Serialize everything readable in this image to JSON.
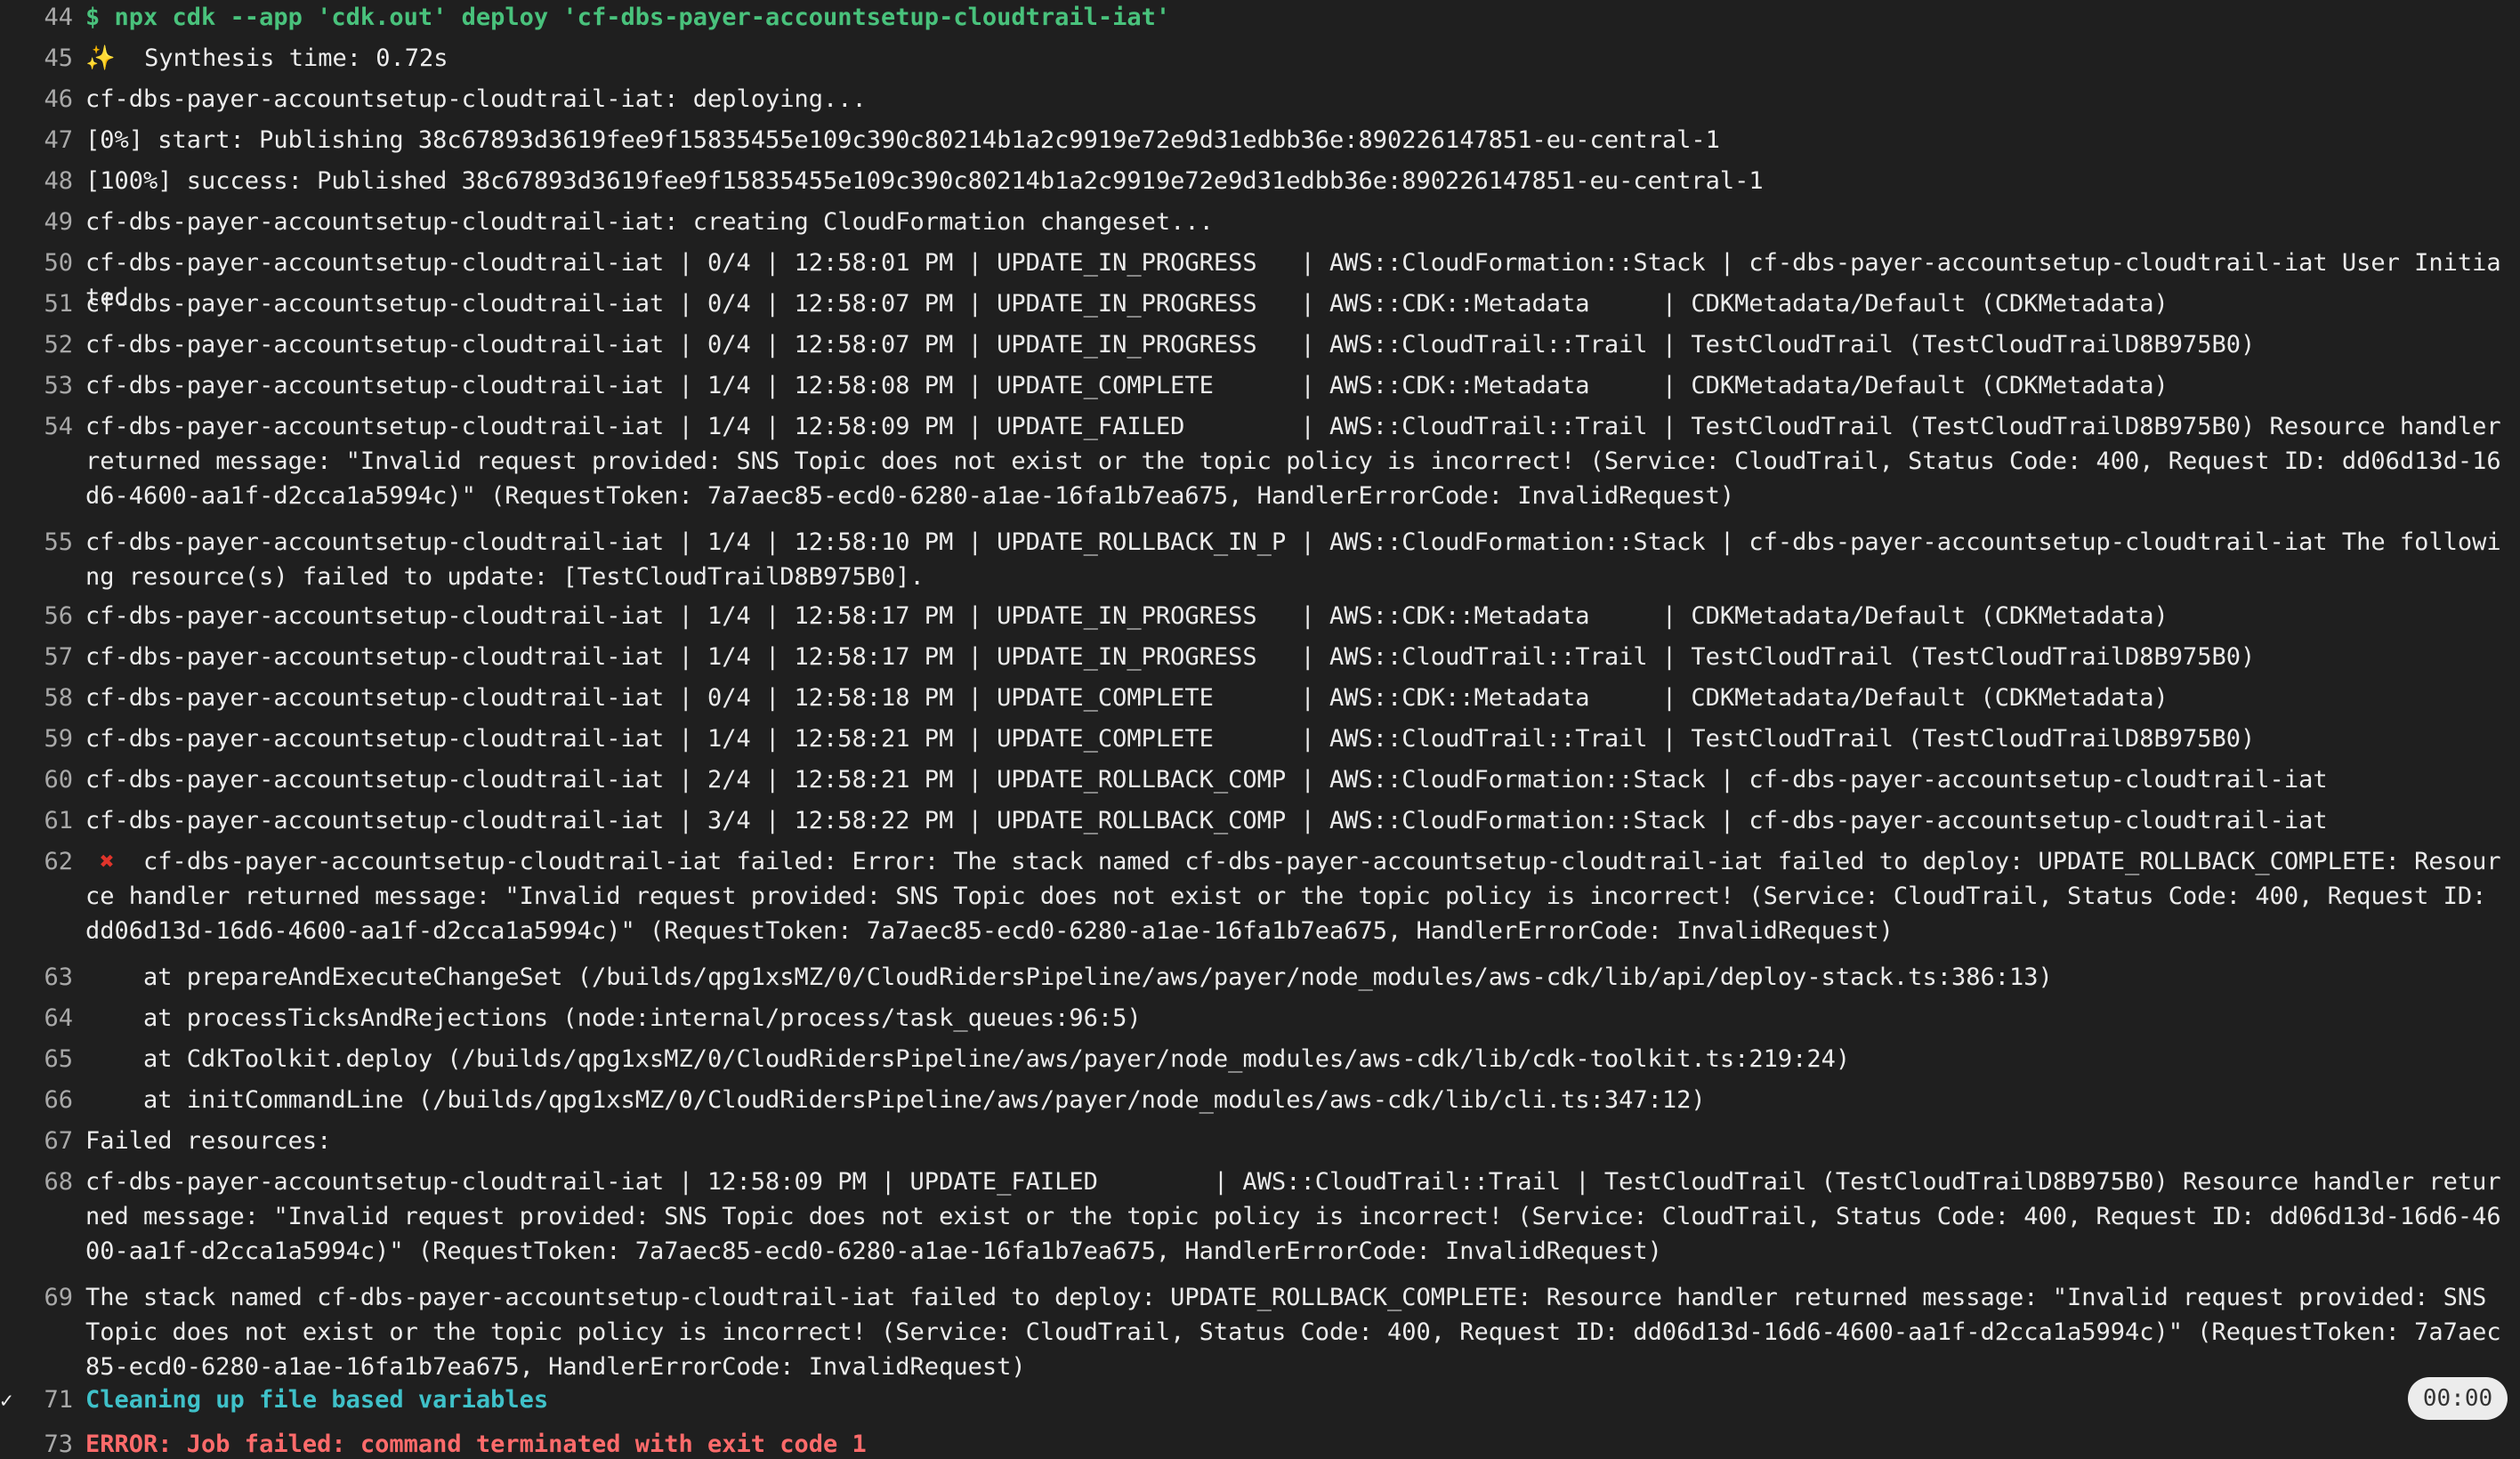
{
  "log": {
    "lines": [
      {
        "n": "44",
        "text": "$ npx cdk --app 'cdk.out' deploy 'cf-dbs-payer-accountsetup-cloudtrail-iat'",
        "style": "green"
      },
      {
        "n": "45",
        "text": "Synthesis time: 0.72s",
        "icon": "sparkle"
      },
      {
        "n": "46",
        "text": "cf-dbs-payer-accountsetup-cloudtrail-iat: deploying..."
      },
      {
        "n": "47",
        "text": "[0%] start: Publishing 38c67893d3619fee9f15835455e109c390c80214b1a2c9919e72e9d31edbb36e:890226147851-eu-central-1"
      },
      {
        "n": "48",
        "text": "[100%] success: Published 38c67893d3619fee9f15835455e109c390c80214b1a2c9919e72e9d31edbb36e:890226147851-eu-central-1"
      },
      {
        "n": "49",
        "text": "cf-dbs-payer-accountsetup-cloudtrail-iat: creating CloudFormation changeset..."
      },
      {
        "n": "50",
        "text": "cf-dbs-payer-accountsetup-cloudtrail-iat | 0/4 | 12:58:01 PM | UPDATE_IN_PROGRESS   | AWS::CloudFormation::Stack | cf-dbs-payer-accountsetup-cloudtrail-iat User Initiated"
      },
      {
        "n": "51",
        "text": "cf-dbs-payer-accountsetup-cloudtrail-iat | 0/4 | 12:58:07 PM | UPDATE_IN_PROGRESS   | AWS::CDK::Metadata     | CDKMetadata/Default (CDKMetadata)"
      },
      {
        "n": "52",
        "text": "cf-dbs-payer-accountsetup-cloudtrail-iat | 0/4 | 12:58:07 PM | UPDATE_IN_PROGRESS   | AWS::CloudTrail::Trail | TestCloudTrail (TestCloudTrailD8B975B0)"
      },
      {
        "n": "53",
        "text": "cf-dbs-payer-accountsetup-cloudtrail-iat | 1/4 | 12:58:08 PM | UPDATE_COMPLETE      | AWS::CDK::Metadata     | CDKMetadata/Default (CDKMetadata)"
      },
      {
        "n": "54",
        "text": "cf-dbs-payer-accountsetup-cloudtrail-iat | 1/4 | 12:58:09 PM | UPDATE_FAILED        | AWS::CloudTrail::Trail | TestCloudTrail (TestCloudTrailD8B975B0) Resource handler returned message: \"Invalid request provided: SNS Topic does not exist or the topic policy is incorrect! (Service: CloudTrail, Status Code: 400, Request ID: dd06d13d-16d6-4600-aa1f-d2cca1a5994c)\" (RequestToken: 7a7aec85-ecd0-6280-a1ae-16fa1b7ea675, HandlerErrorCode: InvalidRequest)"
      },
      {
        "n": "55",
        "text": "cf-dbs-payer-accountsetup-cloudtrail-iat | 1/4 | 12:58:10 PM | UPDATE_ROLLBACK_IN_P | AWS::CloudFormation::Stack | cf-dbs-payer-accountsetup-cloudtrail-iat The following resource(s) failed to update: [TestCloudTrailD8B975B0]."
      },
      {
        "n": "56",
        "text": "cf-dbs-payer-accountsetup-cloudtrail-iat | 1/4 | 12:58:17 PM | UPDATE_IN_PROGRESS   | AWS::CDK::Metadata     | CDKMetadata/Default (CDKMetadata)"
      },
      {
        "n": "57",
        "text": "cf-dbs-payer-accountsetup-cloudtrail-iat | 1/4 | 12:58:17 PM | UPDATE_IN_PROGRESS   | AWS::CloudTrail::Trail | TestCloudTrail (TestCloudTrailD8B975B0)"
      },
      {
        "n": "58",
        "text": "cf-dbs-payer-accountsetup-cloudtrail-iat | 0/4 | 12:58:18 PM | UPDATE_COMPLETE      | AWS::CDK::Metadata     | CDKMetadata/Default (CDKMetadata)"
      },
      {
        "n": "59",
        "text": "cf-dbs-payer-accountsetup-cloudtrail-iat | 1/4 | 12:58:21 PM | UPDATE_COMPLETE      | AWS::CloudTrail::Trail | TestCloudTrail (TestCloudTrailD8B975B0)"
      },
      {
        "n": "60",
        "text": "cf-dbs-payer-accountsetup-cloudtrail-iat | 2/4 | 12:58:21 PM | UPDATE_ROLLBACK_COMP | AWS::CloudFormation::Stack | cf-dbs-payer-accountsetup-cloudtrail-iat"
      },
      {
        "n": "61",
        "text": "cf-dbs-payer-accountsetup-cloudtrail-iat | 3/4 | 12:58:22 PM | UPDATE_ROLLBACK_COMP | AWS::CloudFormation::Stack | cf-dbs-payer-accountsetup-cloudtrail-iat"
      },
      {
        "n": "62",
        "text": "cf-dbs-payer-accountsetup-cloudtrail-iat failed: Error: The stack named cf-dbs-payer-accountsetup-cloudtrail-iat failed to deploy: UPDATE_ROLLBACK_COMPLETE: Resource handler returned message: \"Invalid request provided: SNS Topic does not exist or the topic policy is incorrect! (Service: CloudTrail, Status Code: 400, Request ID: dd06d13d-16d6-4600-aa1f-d2cca1a5994c)\" (RequestToken: 7a7aec85-ecd0-6280-a1ae-16fa1b7ea675, HandlerErrorCode: InvalidRequest)",
        "icon": "cross"
      },
      {
        "n": "63",
        "text": "    at prepareAndExecuteChangeSet (/builds/qpg1xsMZ/0/CloudRidersPipeline/aws/payer/node_modules/aws-cdk/lib/api/deploy-stack.ts:386:13)"
      },
      {
        "n": "64",
        "text": "    at processTicksAndRejections (node:internal/process/task_queues:96:5)"
      },
      {
        "n": "65",
        "text": "    at CdkToolkit.deploy (/builds/qpg1xsMZ/0/CloudRidersPipeline/aws/payer/node_modules/aws-cdk/lib/cdk-toolkit.ts:219:24)"
      },
      {
        "n": "66",
        "text": "    at initCommandLine (/builds/qpg1xsMZ/0/CloudRidersPipeline/aws/payer/node_modules/aws-cdk/lib/cli.ts:347:12)"
      },
      {
        "n": "67",
        "text": "Failed resources:"
      },
      {
        "n": "68",
        "text": "cf-dbs-payer-accountsetup-cloudtrail-iat | 12:58:09 PM | UPDATE_FAILED        | AWS::CloudTrail::Trail | TestCloudTrail (TestCloudTrailD8B975B0) Resource handler returned message: \"Invalid request provided: SNS Topic does not exist or the topic policy is incorrect! (Service: CloudTrail, Status Code: 400, Request ID: dd06d13d-16d6-4600-aa1f-d2cca1a5994c)\" (RequestToken: 7a7aec85-ecd0-6280-a1ae-16fa1b7ea675, HandlerErrorCode: InvalidRequest)"
      },
      {
        "n": "69",
        "text": "The stack named cf-dbs-payer-accountsetup-cloudtrail-iat failed to deploy: UPDATE_ROLLBACK_COMPLETE: Resource handler returned message: \"Invalid request provided: SNS Topic does not exist or the topic policy is incorrect! (Service: CloudTrail, Status Code: 400, Request ID: dd06d13d-16d6-4600-aa1f-d2cca1a5994c)\" (RequestToken: 7a7aec85-ecd0-6280-a1ae-16fa1b7ea675, HandlerErrorCode: InvalidRequest)"
      },
      {
        "n": "71",
        "text": "Cleaning up file based variables",
        "style": "teal",
        "check": true
      },
      {
        "n": "73",
        "text": "ERROR: Job failed: command terminated with exit code 1",
        "style": "red"
      }
    ],
    "timer_badge": "00:00",
    "colors": {
      "background": "#1f1f1f",
      "text": "#ececec",
      "line_number": "#a9a9a9",
      "command_green": "#49c27c",
      "section_teal": "#3fc1c9",
      "error_red": "#ff6b6b"
    },
    "icons": {
      "sparkle": "sparkles-icon",
      "cross": "cross-mark-icon",
      "check": "checkmark-icon"
    }
  }
}
